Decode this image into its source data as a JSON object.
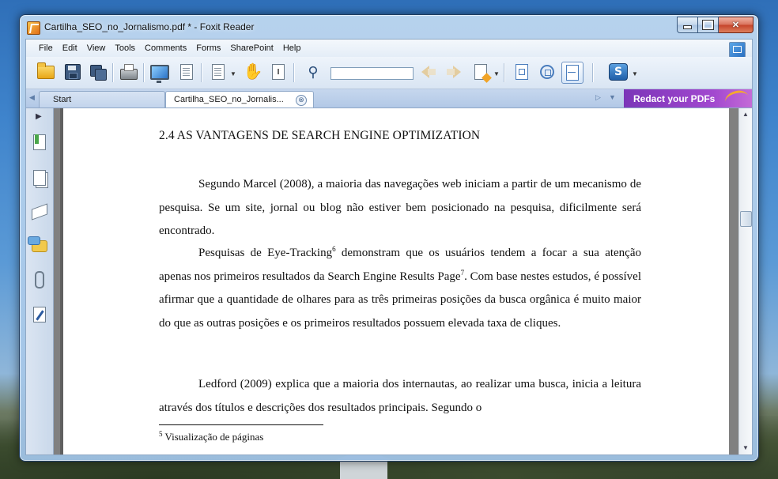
{
  "window": {
    "title": "Cartilha_SEO_no_Jornalismo.pdf * - Foxit Reader"
  },
  "menu": [
    "File",
    "Edit",
    "View",
    "Tools",
    "Comments",
    "Forms",
    "SharePoint",
    "Help"
  ],
  "toolbar": {
    "icons": [
      "open-folder",
      "save",
      "save-all",
      "print",
      "screen-capture",
      "properties",
      "page-dropdown",
      "hand-tool",
      "select-text",
      "find",
      "find-previous",
      "find-next",
      "comment-tools",
      "actual-size",
      "fit-page",
      "fit-width",
      "foxit-sharepoint"
    ],
    "search_value": ""
  },
  "tabs": {
    "start": "Start",
    "active": "Cartilha_SEO_no_Jornalis...",
    "close_glyph": "⊗"
  },
  "promo": {
    "label": "Redact your PDFs"
  },
  "sidebar": {
    "icons": [
      "bookmarks",
      "pages",
      "layers",
      "comments",
      "attachments",
      "signatures"
    ]
  },
  "document": {
    "heading": "2.4 AS VANTAGENS DE SEARCH ENGINE OPTIMIZATION",
    "p1": "Segundo Marcel (2008), a maioria das navegações web iniciam a partir de um mecanismo de pesquisa. Se um site, jornal ou blog não estiver bem posicionado na pesquisa, dificilmente será encontrado.",
    "p2a": "Pesquisas de Eye-Tracking",
    "p2sup1": "6",
    "p2b": " demonstram que os usuários tendem a focar a sua atenção apenas nos primeiros resultados da Search Engine Results Page",
    "p2sup2": "7",
    "p2c": ". Com base nestes estudos, é possível afirmar que a quantidade de olhares para as três primeiras posições da busca orgânica é muito maior do que as outras posições e os primeiros resultados possuem elevada taxa de cliques.",
    "p3": "Ledford (2009) explica que a maioria dos internautas, ao realizar uma busca, inicia a leitura através dos títulos e descrições dos resultados principais. Segundo o",
    "footnote_num": "5",
    "footnote_text": " Visualização de páginas"
  },
  "colors": {
    "promo": "#a248cf",
    "frame": "#b4cde8",
    "page_bg": "#ffffff"
  }
}
